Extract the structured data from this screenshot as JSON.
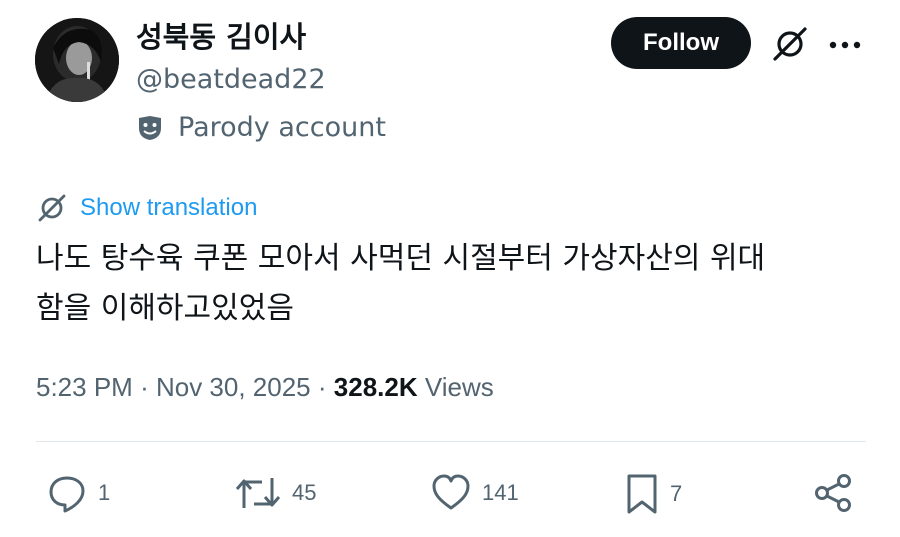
{
  "author": {
    "display_name": "성북동 김이사",
    "handle": "@beatdead22",
    "badge_label": "Parody account",
    "badge_icon": "theater-masks-icon"
  },
  "header": {
    "follow_label": "Follow",
    "grok_icon": "grok-icon",
    "more_icon": "more-icon"
  },
  "translation": {
    "label": "Show translation",
    "icon": "grok-icon"
  },
  "tweet": {
    "text_lines": [
      "나도 탕수육 쿠폰 모아서 사먹던 시절부터 가상자산의 위대",
      "함을 이해하고있었음"
    ]
  },
  "meta": {
    "time": "5:23 PM",
    "separator": "·",
    "date": "Nov 30, 2025",
    "views_count": "328.2K",
    "views_label": "Views"
  },
  "actions": {
    "reply": {
      "icon": "reply-icon",
      "count": "1"
    },
    "repost": {
      "icon": "repost-icon",
      "count": "45"
    },
    "like": {
      "icon": "heart-icon",
      "count": "141"
    },
    "bookmark": {
      "icon": "bookmark-icon",
      "count": "7"
    },
    "share": {
      "icon": "share-icon"
    }
  },
  "colors": {
    "text_primary": "#0f1419",
    "text_secondary": "#536471",
    "link": "#1d9bf0",
    "follow_bg": "#0f1419"
  }
}
